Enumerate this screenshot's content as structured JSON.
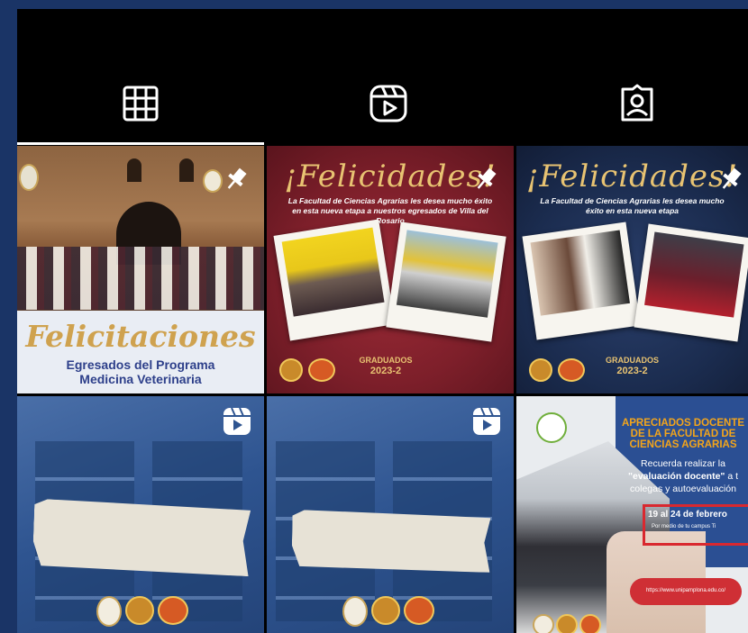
{
  "tabs": [
    {
      "name": "posts",
      "icon": "grid-icon",
      "active": true
    },
    {
      "name": "reels",
      "icon": "reels-icon",
      "active": false
    },
    {
      "name": "tagged",
      "icon": "tagged-user-icon",
      "active": false
    }
  ],
  "posts": [
    {
      "type": "image",
      "pinned": true,
      "title": "Felicitaciones",
      "subtitle_line1": "Egresados del Programa",
      "subtitle_line2": "Medicina Veterinaria"
    },
    {
      "type": "image",
      "pinned": true,
      "headline": "¡Felicidades!",
      "body": "La Facultad de Ciencias Agrarias les desea mucho éxito en esta nueva etapa a nuestros egresados de Villa del Rosario",
      "badge_line1": "GRADUADOS",
      "badge_line2": "2023-2"
    },
    {
      "type": "image",
      "pinned": true,
      "headline": "¡Felicidades!",
      "body": "La Facultad de Ciencias Agrarias les desea mucho éxito en esta nueva etapa",
      "badge_line1": "GRADUADOS",
      "badge_line2": "2023-2"
    },
    {
      "type": "reel",
      "pinned": false
    },
    {
      "type": "reel",
      "pinned": false
    },
    {
      "type": "image",
      "pinned": false,
      "heading_line1": "APRECIADOS DOCENTE",
      "heading_line2": "DE LA FACULTAD DE",
      "heading_line3": "CIENCIAS AGRARIAS",
      "body_line1": "Recuerda realizar la",
      "body_line2_bold": "\"evaluación docente\"",
      "body_line2_rest": " a t",
      "body_line3": "colegas y autoevaluación",
      "date": "19 al 24 de febrero",
      "date_sub": "Por medio de tu campus Ti",
      "url": "https://www.unipamplona.edu.co/"
    }
  ],
  "colors": {
    "background": "#1a3466",
    "maroon": "#7d1f2a",
    "navy": "#1b2c4f",
    "gold": "#e8c372"
  }
}
